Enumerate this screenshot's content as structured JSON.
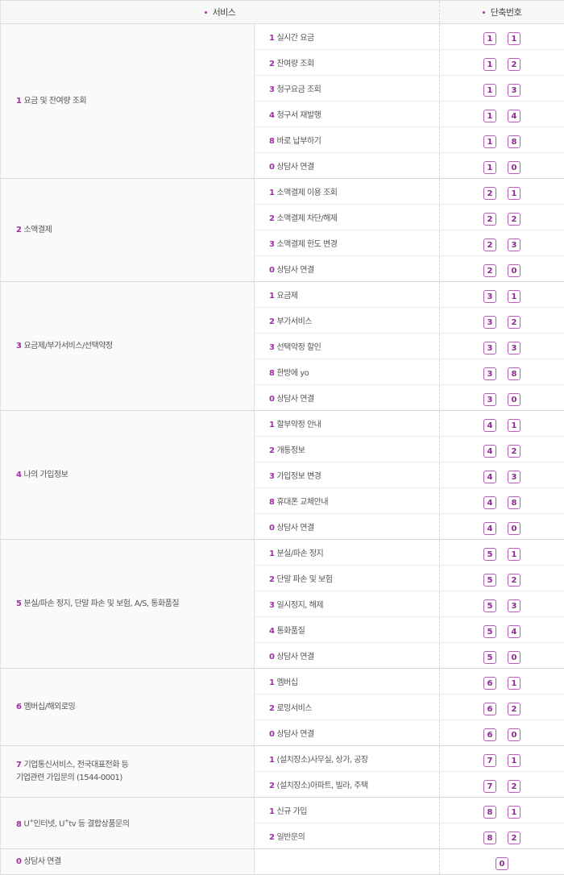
{
  "header": {
    "service": "서비스",
    "shortcut": "단축번호"
  },
  "colors": {
    "accent": "#a02da3",
    "key_border": "#b85cbc"
  },
  "groups": [
    {
      "num": "1",
      "label": "요금 및 잔여량 조회",
      "items": [
        {
          "num": "1",
          "label": "실시간 요금",
          "keys": [
            "1",
            "1"
          ]
        },
        {
          "num": "2",
          "label": "잔여량 조회",
          "keys": [
            "1",
            "2"
          ]
        },
        {
          "num": "3",
          "label": "청구요금 조회",
          "keys": [
            "1",
            "3"
          ]
        },
        {
          "num": "4",
          "label": "청구서 재발행",
          "keys": [
            "1",
            "4"
          ]
        },
        {
          "num": "8",
          "label": "바로 납부하기",
          "keys": [
            "1",
            "8"
          ]
        },
        {
          "num": "0",
          "label": "상담사 연결",
          "keys": [
            "1",
            "0"
          ]
        }
      ]
    },
    {
      "num": "2",
      "label": "소액결제",
      "items": [
        {
          "num": "1",
          "label": "소액결제 이용 조회",
          "keys": [
            "2",
            "1"
          ]
        },
        {
          "num": "2",
          "label": "소액결제 차단/해제",
          "keys": [
            "2",
            "2"
          ]
        },
        {
          "num": "3",
          "label": "소액결제 한도 변경",
          "keys": [
            "2",
            "3"
          ]
        },
        {
          "num": "0",
          "label": "상담사 연결",
          "keys": [
            "2",
            "0"
          ]
        }
      ]
    },
    {
      "num": "3",
      "label": "요금제/부가서비스/선택약정",
      "items": [
        {
          "num": "1",
          "label": "요금제",
          "keys": [
            "3",
            "1"
          ]
        },
        {
          "num": "2",
          "label": "부가서비스",
          "keys": [
            "3",
            "2"
          ]
        },
        {
          "num": "3",
          "label": "선택약정 할인",
          "keys": [
            "3",
            "3"
          ]
        },
        {
          "num": "8",
          "label": "한방에 yo",
          "keys": [
            "3",
            "8"
          ]
        },
        {
          "num": "0",
          "label": "상담사 연결",
          "keys": [
            "3",
            "0"
          ]
        }
      ]
    },
    {
      "num": "4",
      "label": "나의 가입정보",
      "items": [
        {
          "num": "1",
          "label": "할부약정 안내",
          "keys": [
            "4",
            "1"
          ]
        },
        {
          "num": "2",
          "label": "개통정보",
          "keys": [
            "4",
            "2"
          ]
        },
        {
          "num": "3",
          "label": "가입정보 변경",
          "keys": [
            "4",
            "3"
          ]
        },
        {
          "num": "8",
          "label": "휴대폰 교체안내",
          "keys": [
            "4",
            "8"
          ]
        },
        {
          "num": "0",
          "label": "상담사 연결",
          "keys": [
            "4",
            "0"
          ]
        }
      ]
    },
    {
      "num": "5",
      "label": "분실/파손 정지, 단말 파손 및 보험, A/S, 통화품질",
      "items": [
        {
          "num": "1",
          "label": "분실/파손 정지",
          "keys": [
            "5",
            "1"
          ]
        },
        {
          "num": "2",
          "label": "단말 파손 및 보험",
          "keys": [
            "5",
            "2"
          ]
        },
        {
          "num": "3",
          "label": "일시정지, 해제",
          "keys": [
            "5",
            "3"
          ]
        },
        {
          "num": "4",
          "label": "통화품질",
          "keys": [
            "5",
            "4"
          ]
        },
        {
          "num": "0",
          "label": "상담사 연결",
          "keys": [
            "5",
            "0"
          ]
        }
      ]
    },
    {
      "num": "6",
      "label": "멤버십/해외로밍",
      "items": [
        {
          "num": "1",
          "label": "멤버십",
          "keys": [
            "6",
            "1"
          ]
        },
        {
          "num": "2",
          "label": "로밍서비스",
          "keys": [
            "6",
            "2"
          ]
        },
        {
          "num": "0",
          "label": "상담사 연결",
          "keys": [
            "6",
            "0"
          ]
        }
      ]
    },
    {
      "num": "7",
      "label": "기업통신서비스, 전국대표전화 등",
      "label2": "기업관련 가입문의 (1544-0001)",
      "items": [
        {
          "num": "1",
          "label": "(설치장소)사무실, 상가, 공장",
          "keys": [
            "7",
            "1"
          ]
        },
        {
          "num": "2",
          "label": "(설치장소)아파트, 빌라, 주택",
          "keys": [
            "7",
            "2"
          ]
        }
      ]
    },
    {
      "num": "8",
      "label_parts": [
        "U",
        "+",
        "인터넷, U",
        "+",
        "tv 등 결합상품문의"
      ],
      "items": [
        {
          "num": "1",
          "label": "신규 가입",
          "keys": [
            "8",
            "1"
          ]
        },
        {
          "num": "2",
          "label": "일반문의",
          "keys": [
            "8",
            "2"
          ]
        }
      ]
    },
    {
      "num": "0",
      "label": "상담사 연결",
      "items": [
        {
          "num": "",
          "label": "",
          "keys": [
            "0"
          ]
        }
      ]
    }
  ]
}
